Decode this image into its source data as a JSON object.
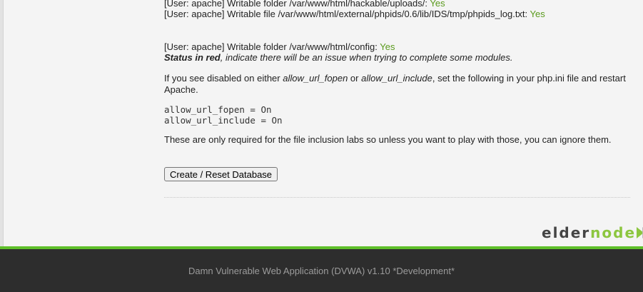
{
  "checks": [
    {
      "prefix": "[User: apache] Writable folder /var/www/html/hackable/uploads/:",
      "status": "Yes"
    },
    {
      "prefix": "[User: apache] Writable file /var/www/html/external/phpids/0.6/lib/IDS/tmp/phpids_log.txt:",
      "status": "Yes"
    },
    {
      "prefix": "[User: apache] Writable folder /var/www/html/config:",
      "status": "Yes"
    }
  ],
  "status_note": {
    "bold": "Status in red",
    "rest": ", indicate there will be an issue when trying to complete some modules."
  },
  "disabled_note": {
    "part1": "If you see disabled on either ",
    "fopen": "allow_url_fopen",
    "part2": " or ",
    "include": "allow_url_include",
    "part3": ", set the following in your php.ini file and restart Apache."
  },
  "config_lines": [
    "allow_url_fopen = On",
    "allow_url_include = On"
  ],
  "inclusion_note": "These are only required for the file inclusion labs so unless you want to play with those, you can ignore them.",
  "button_label": "Create / Reset Database",
  "logo": {
    "dark": "elder",
    "accent": "node"
  },
  "footer_text": "Damn Vulnerable Web Application (DVWA) v1.10 *Development*",
  "colors": {
    "status_yes": "#5a9a1c",
    "footer_bg": "#2d2d2d",
    "footer_accent": "#5fbf2a"
  }
}
